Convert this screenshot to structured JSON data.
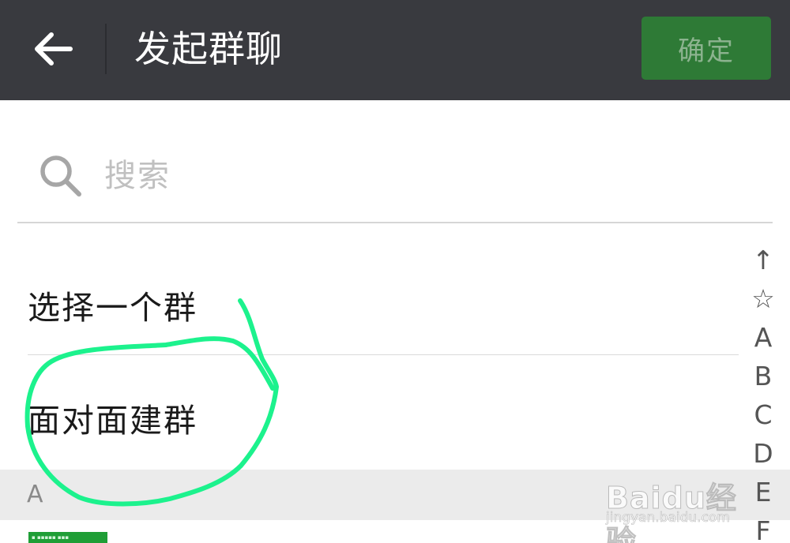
{
  "header": {
    "title": "发起群聊",
    "confirm_label": "确定"
  },
  "search": {
    "placeholder": "搜索",
    "value": ""
  },
  "options": [
    {
      "label": "选择一个群"
    },
    {
      "label": "面对面建群"
    }
  ],
  "section": {
    "letter": "A"
  },
  "index": [
    "↑",
    "☆",
    "A",
    "B",
    "C",
    "D",
    "E",
    "F"
  ],
  "watermark": {
    "brand": "Baidu经验",
    "url": "jingyan.baidu.com"
  },
  "colors": {
    "topbar": "#393a3f",
    "confirm_button": "#2e7a36",
    "annotation_circle": "#1cf28d",
    "section_header": "#ebebeb"
  }
}
